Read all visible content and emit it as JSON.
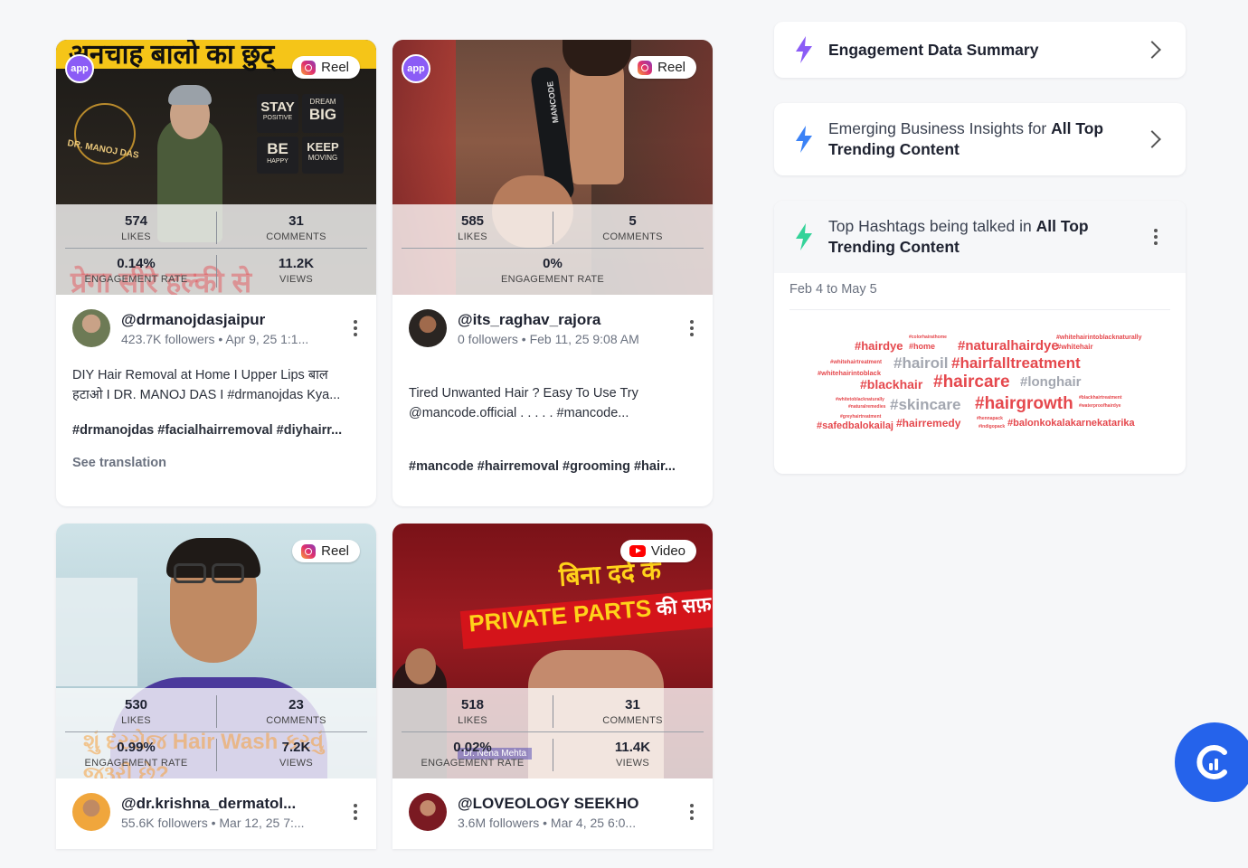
{
  "cards": [
    {
      "platform": "Reel",
      "likes": "574",
      "likes_label": "LIKES",
      "comments": "31",
      "comments_label": "COMMENTS",
      "engagement": "0.14%",
      "engagement_label": "ENGAGEMENT RATE",
      "views": "11.2K",
      "views_label": "VIEWS",
      "handle": "@drmanojdasjaipur",
      "meta": "423.7K followers • Apr 9, 25 1:1...",
      "caption": "DIY Hair Removal at Home I Upper Lips बाल हटाओ I DR. MANOJ DAS I #drmanojdas Kya...",
      "hashtags": "#drmanojdas #facialhairremoval #diyhairr...",
      "see_translation": "See translation",
      "thumb_banner": "अनचाह बालो का छुट्",
      "thumb_sign": "DR. MANOJ DAS",
      "thumb_tiles": [
        "STAY",
        "POSITIVE",
        "DREAM",
        "BIG",
        "BE",
        "HAPPY",
        "KEEP",
        "MOVING"
      ],
      "thumb_overlay": "प्रेगा सीरे हल्की से"
    },
    {
      "platform": "Reel",
      "likes": "585",
      "likes_label": "LIKES",
      "comments": "5",
      "comments_label": "COMMENTS",
      "engagement": "0%",
      "engagement_label": "ENGAGEMENT RATE",
      "handle": "@its_raghav_rajora",
      "meta": "0 followers • Feb 11, 25 9:08 AM",
      "caption": "Tired Unwanted Hair ? Easy To Use Try @mancode.official . . . . . #mancode...",
      "hashtags": "#mancode #hairremoval #grooming #hair...",
      "thumb_product": "MANCODE"
    },
    {
      "platform": "Reel",
      "likes": "530",
      "likes_label": "LIKES",
      "comments": "23",
      "comments_label": "COMMENTS",
      "engagement": "0.99%",
      "engagement_label": "ENGAGEMENT RATE",
      "views": "7.2K",
      "views_label": "VIEWS",
      "handle": "@dr.krishna_dermatol...",
      "meta": "55.6K followers • Mar 12, 25 7:...",
      "thumb_overlay": "શું દરરોજ Hair Wash કરવું જરૂરી છે?"
    },
    {
      "platform": "Video",
      "likes": "518",
      "likes_label": "LIKES",
      "comments": "31",
      "comments_label": "COMMENTS",
      "engagement": "0.02%",
      "engagement_label": "ENGAGEMENT RATE",
      "views": "11.4K",
      "views_label": "VIEWS",
      "handle": "@LOVEOLOGY SEEKHO",
      "meta": "3.6M followers • Mar 4, 25 6:0...",
      "thumb_hindi": "बिना दर्द के",
      "thumb_english": "PRIVATE PARTS",
      "thumb_suffix": "की सफ़",
      "thumb_name": "Dr. Neha Mehta"
    }
  ],
  "panels": {
    "summary": {
      "title": "Engagement Data Summary"
    },
    "insights": {
      "prefix": "Emerging Business Insights for ",
      "bold1": "All Top",
      "line2": "Trending Content"
    },
    "hashtags": {
      "prefix": "Top Hashtags being talked in ",
      "bold1": "All Top",
      "line2": "Trending Content",
      "date_range": "Feb 4 to May 5",
      "words": [
        "#colorhairathome",
        "#whitehairintoblacknaturally",
        "#hairdye",
        "#home",
        "#naturalhairdye",
        "#whitehair",
        "#whitehairtreatment",
        "#hairoil",
        "#hairfalltreatment",
        "#whitehairintoblack",
        "#blackhair",
        "#haircare",
        "#longhair",
        "#whitetoblacknaturally",
        "#naturalremedies",
        "#skincare",
        "#hairgrowth",
        "#blackhairtreatment",
        "#waterproofhairdye",
        "#greyhairtreatment",
        "#safedbalokailaj",
        "#hairremedy",
        "#hennapack",
        "#indigopack",
        "#balonkokalakarnekatarika"
      ]
    }
  },
  "colors": {
    "accent": "#2563eb",
    "hashtag": "#e5484d",
    "bolt_purple": "#8b5cf6",
    "bolt_blue": "#3b82f6",
    "bolt_green": "#34d399"
  }
}
